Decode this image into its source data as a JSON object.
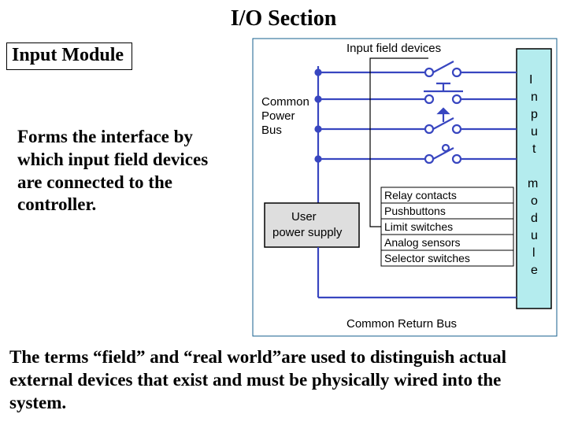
{
  "title": "I/O  Section",
  "subtitle": "Input Module",
  "para1": "Forms the interface by which input field devices are connected to the controller.",
  "para2": "The terms “field” and “real world”are used to distinguish actual external devices that exist and must be physically wired into the system.",
  "diagram": {
    "topLabel": "Input field devices",
    "leftLabel1": "Common",
    "leftLabel2": "Power",
    "leftLabel3": "Bus",
    "userPS1": "User",
    "userPS2": "power supply",
    "module1": "I",
    "module2": "n",
    "module3": "p",
    "module4": "u",
    "module5": "t",
    "module6": "m",
    "module7": "o",
    "module8": "d",
    "module9": "u",
    "module10": "l",
    "module11": "e",
    "dev1": "Relay contacts",
    "dev2": "Pushbuttons",
    "dev3": "Limit switches",
    "dev4": "Analog sensors",
    "dev5": "Selector switches",
    "bottomLabel": "Common Return Bus"
  }
}
